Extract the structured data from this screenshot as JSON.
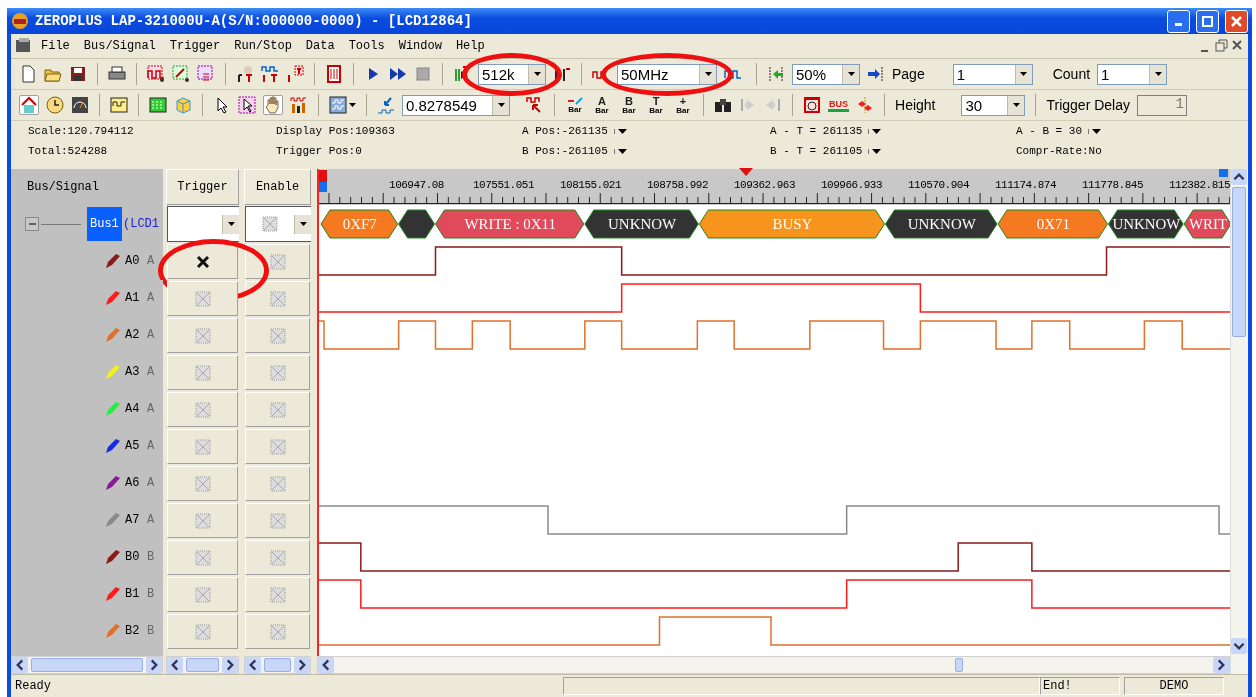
{
  "window": {
    "title": "ZEROPLUS LAP-321000U-A(S/N:000000-0000) - [LCD12864]"
  },
  "menu": [
    {
      "label": "File"
    },
    {
      "label": "Bus/Signal"
    },
    {
      "label": "Trigger"
    },
    {
      "label": "Run/Stop"
    },
    {
      "label": "Data"
    },
    {
      "label": "Tools"
    },
    {
      "label": "Window"
    },
    {
      "label": "Help"
    }
  ],
  "toolbar": {
    "sample_depth": "512k",
    "sample_rate": "50MHz",
    "zoom": "50%",
    "page_label": "Page",
    "page_value": "1",
    "count_label": "Count",
    "count_value": "1",
    "threshold": "0.8278549",
    "pan_tool_selected": true,
    "bar_tools": [
      {
        "kind": "plain",
        "caption": "Bar"
      },
      {
        "kind": "lettered",
        "letter": "A",
        "caption": "Bar"
      },
      {
        "kind": "lettered",
        "letter": "B",
        "caption": "Bar"
      },
      {
        "kind": "lettered",
        "letter": "T",
        "caption": "Bar"
      },
      {
        "kind": "lettered",
        "letter": "+",
        "caption": "Bar"
      }
    ],
    "bus_tool_caption": "BUS",
    "height_label": "Height",
    "height_value": "30",
    "trigger_delay_label": "Trigger Delay",
    "trigger_delay_value": "1"
  },
  "info": [
    {
      "text": "Scale:120.794112",
      "kind": "plain"
    },
    {
      "text": "Display Pos:109363",
      "kind": "plain"
    },
    {
      "text": "A Pos:-261135",
      "kind": "dropdown"
    },
    {
      "text": "A - T = 261135",
      "kind": "dropdown"
    },
    {
      "text": "A - B = 30",
      "kind": "dropdown"
    },
    {
      "text": "Total:524288",
      "kind": "plain"
    },
    {
      "text": "Trigger Pos:0",
      "kind": "plain"
    },
    {
      "text": "B Pos:-261105",
      "kind": "dropdown"
    },
    {
      "text": "B - T = 261105",
      "kind": "dropdown"
    },
    {
      "text": "Compr-Rate:No",
      "kind": "plain"
    }
  ],
  "columns": [
    "Bus/Signal",
    "Trigger",
    "Enable"
  ],
  "ruler": [
    "106947.08",
    "107551.051",
    "108155.021",
    "108758.992",
    "109362.963",
    "109966.933",
    "110570.904",
    "111174.874",
    "111778.845",
    "112382.815"
  ],
  "bus": {
    "name": "Bus1",
    "description": "(LCD1",
    "selected": true,
    "expanded": true,
    "decode": [
      {
        "label": "0XF7",
        "color": "#f47920"
      },
      {
        "color": "#333333"
      },
      {
        "label": "WRITE : 0X11",
        "color": "#e04a5a"
      },
      {
        "label": "UNKNOW",
        "color": "#333333"
      },
      {
        "label": "BUSY",
        "color": "#f7941d"
      },
      {
        "label": "UNKNOW",
        "color": "#333333"
      },
      {
        "label": "0X71",
        "color": "#f47920"
      },
      {
        "label": "UNKNOW",
        "color": "#333333"
      },
      {
        "label": "WRIT",
        "color": "#e04a5a"
      }
    ],
    "children": [
      {
        "name": "A0",
        "alias": "A",
        "color": "#8b1a1a",
        "trigger_set": true
      },
      {
        "name": "A1",
        "alias": "A",
        "color": "#ff1a1a",
        "trigger_set": false
      },
      {
        "name": "A2",
        "alias": "A",
        "color": "#e0702a",
        "trigger_set": false
      },
      {
        "name": "A3",
        "alias": "A",
        "color": "#f0f020",
        "trigger_set": false
      },
      {
        "name": "A4",
        "alias": "A",
        "color": "#20f040",
        "trigger_set": false
      },
      {
        "name": "A5",
        "alias": "A",
        "color": "#1a2ae0",
        "trigger_set": false
      },
      {
        "name": "A6",
        "alias": "A",
        "color": "#8a1a9a",
        "trigger_set": false
      },
      {
        "name": "A7",
        "alias": "A",
        "color": "#8a8a8a",
        "trigger_set": false
      },
      {
        "name": "B0",
        "alias": "B",
        "color": "#8b1a1a",
        "trigger_set": false
      },
      {
        "name": "B1",
        "alias": "B",
        "color": "#ff1a1a",
        "trigger_set": false
      },
      {
        "name": "B2",
        "alias": "B",
        "color": "#e0702a",
        "trigger_set": false
      }
    ]
  },
  "status_bar": {
    "message": "Ready",
    "end": "End!",
    "mode": "DEMO"
  }
}
